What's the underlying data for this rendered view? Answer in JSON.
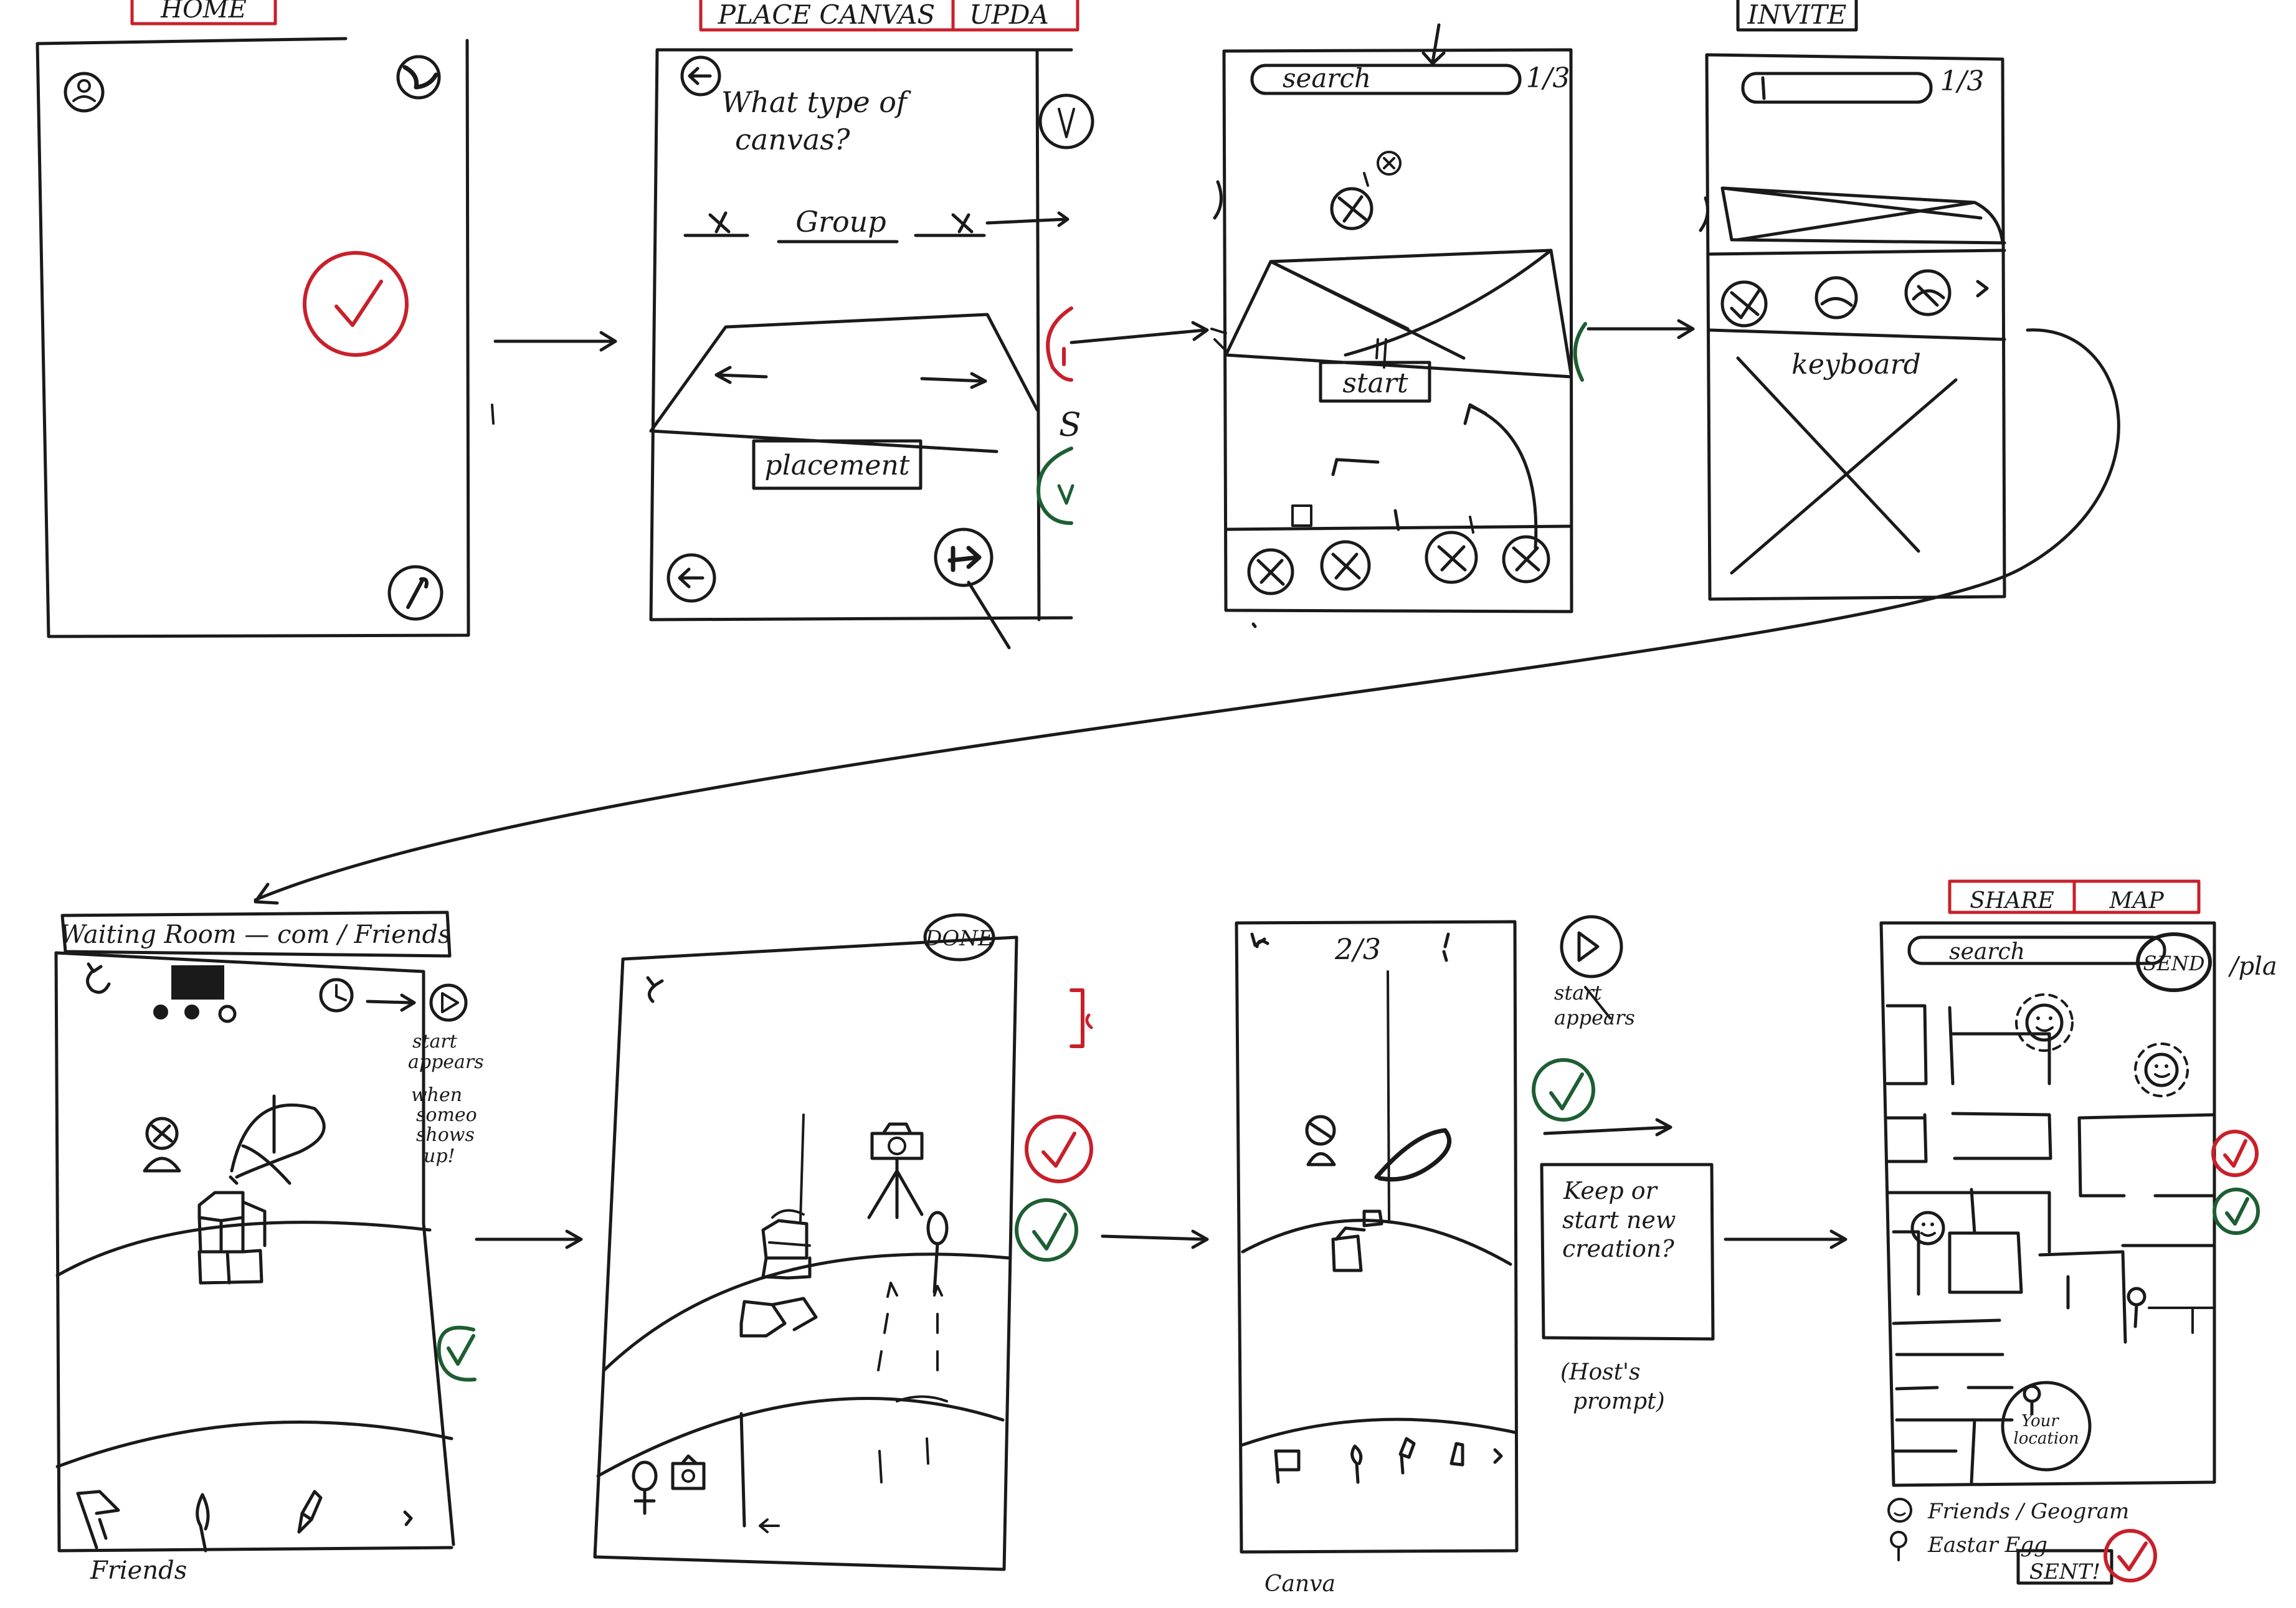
{
  "colors": {
    "ink": "#1a1a1a",
    "accept": "#c8202a",
    "confirm": "#1d5e33",
    "paper": "#ffffff"
  },
  "icons": [
    "profile-icon",
    "globe-icon",
    "brush-icon",
    "check-icon",
    "back-arrow-icon",
    "compass-icon",
    "clock-icon",
    "play-icon",
    "flag-icon",
    "camera-icon",
    "tripod-icon",
    "pin-icon",
    "smiley-icon"
  ],
  "screen1": {
    "header": "HOME"
  },
  "screen2": {
    "header": "PLACE CANVAS",
    "header2": "UPDA",
    "question_line1": "What type of",
    "question_line2": "canvas?",
    "option_center": "Group",
    "placement_label": "placement",
    "side_letter": "S"
  },
  "screen3": {
    "search_label": "search",
    "page": "1/3",
    "start_label": "start"
  },
  "screen4": {
    "header": "INVITE",
    "page": "1/3",
    "keyboard_label": "keyboard"
  },
  "screen5": {
    "header": "Waiting Room — com / Friends",
    "note": [
      "start",
      "appears",
      "when",
      "someo",
      "shows",
      "up!"
    ],
    "footer": "Friends"
  },
  "screen6": {
    "done_label": "DONE"
  },
  "screen7": {
    "page": "2/3",
    "note": [
      "start",
      "appears"
    ],
    "prompt": [
      "Keep or",
      "start new",
      "creation?"
    ],
    "host_note": [
      "(Host's",
      "prompt)"
    ],
    "footer": "Canva"
  },
  "screen8": {
    "header": "SHARE",
    "header2": "MAP",
    "search_label": "search",
    "send_label": "SEND",
    "side_text": "/pla",
    "location_label": [
      "Your",
      "location"
    ],
    "legend_friends": "Friends / Geogram",
    "legend_easter": "Eastar Egg",
    "sent_label": "SENT!"
  }
}
